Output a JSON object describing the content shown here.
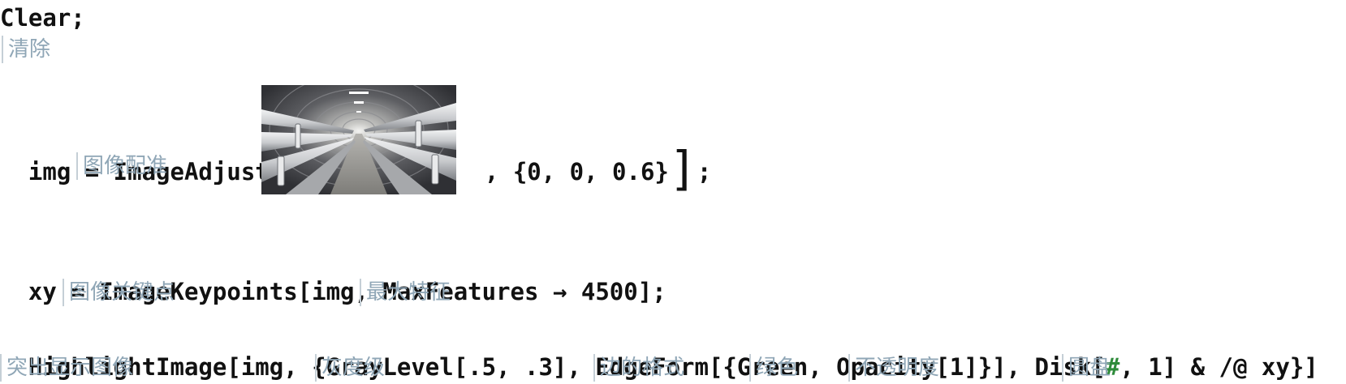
{
  "lines": {
    "clear": {
      "code": "Clear;",
      "hint": "清除"
    },
    "img": {
      "prefix": "img = ImageAdjust",
      "hint_image_adjust": "图像配准",
      "suffix": ", {0, 0, 0.6}",
      "terminator": ";"
    },
    "xy": {
      "prefix": "xy = ImageKeypoints[img, ",
      "option": "MaxFeatures",
      "arrow": "→",
      "value": "4500];",
      "hint_keypoints": "图像关键点",
      "hint_max_features": "最大特征"
    },
    "highlight": {
      "part1": "HighlightImage[img, {GrayLevel[.5, .3], EdgeForm[{Green, Opacity[1]}], Disk[",
      "slot": "#",
      "part2": ", 1] & /@ xy}]",
      "hints": [
        "突出显示图像",
        "灰度级",
        "边的格式",
        "绿色",
        "不透明度",
        "圆盘"
      ]
    }
  },
  "image": {
    "subject": "tunnel-with-pipes-photo",
    "colors": {
      "ceiling": "#6b6b70",
      "floor": "#9a9a96",
      "pipe": "#d7d9dc",
      "pipe_shadow": "#8a8d92"
    }
  },
  "colors": {
    "code_text": "#111111",
    "hint_text": "#8fa6b6",
    "hint_bar": "#c5cfd6",
    "slot_green": "#2e8b3a"
  }
}
